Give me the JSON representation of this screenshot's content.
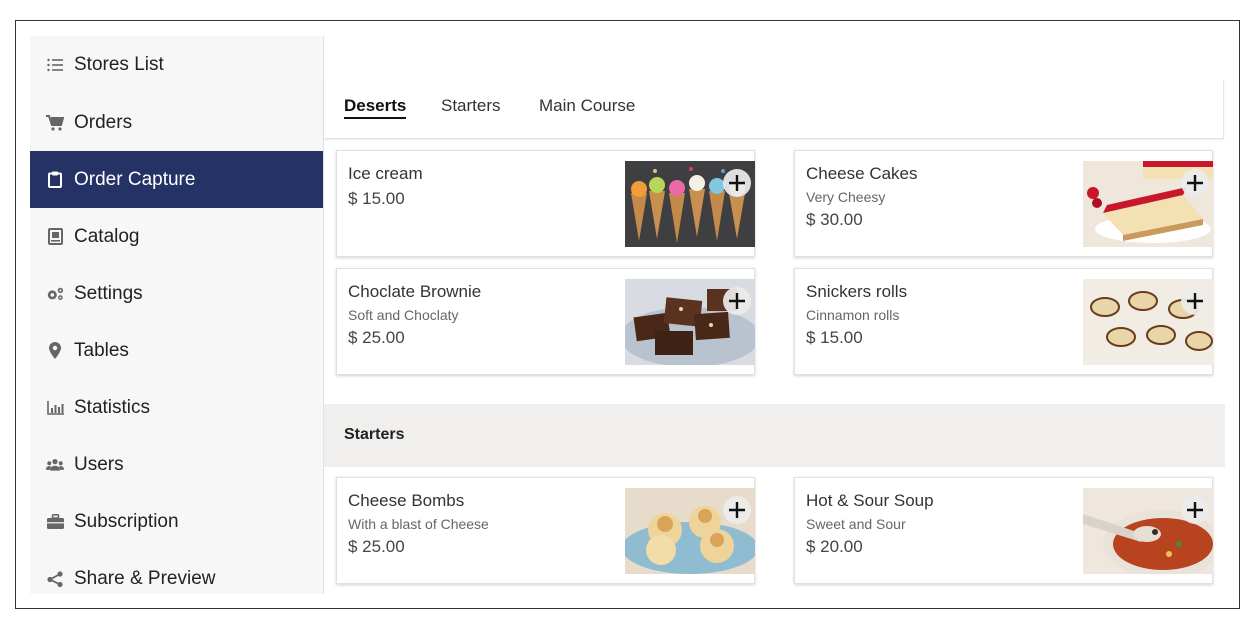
{
  "sidebar": {
    "title": "Stores List",
    "items": [
      {
        "label": "Orders",
        "icon": "cart-icon"
      },
      {
        "label": "Order Capture",
        "icon": "clipboard-icon",
        "active": true
      },
      {
        "label": "Catalog",
        "icon": "catalog-icon"
      },
      {
        "label": "Settings",
        "icon": "gears-icon"
      },
      {
        "label": "Tables",
        "icon": "map-pin-icon"
      },
      {
        "label": "Statistics",
        "icon": "bar-chart-icon"
      },
      {
        "label": "Users",
        "icon": "users-icon"
      },
      {
        "label": "Subscription",
        "icon": "briefcase-icon"
      },
      {
        "label": "Share & Preview",
        "icon": "share-icon"
      }
    ]
  },
  "tabs": [
    {
      "label": "Deserts",
      "active": true
    },
    {
      "label": "Starters"
    },
    {
      "label": "Main Course"
    }
  ],
  "deserts": [
    {
      "name": "Ice cream",
      "desc": "",
      "price": "$ 15.00",
      "image": "ice-cream-cones-image"
    },
    {
      "name": "Cheese Cakes",
      "desc": "Very Cheesy",
      "price": "$ 30.00",
      "image": "cheesecake-image"
    },
    {
      "name": "Choclate Brownie",
      "desc": "Soft and Choclaty",
      "price": "$ 25.00",
      "image": "brownie-image"
    },
    {
      "name": "Snickers rolls",
      "desc": "Cinnamon rolls",
      "price": "$ 15.00",
      "image": "snickers-rolls-image"
    }
  ],
  "starters_section": {
    "title": "Starters",
    "items": [
      {
        "name": "Cheese Bombs",
        "desc": "With a blast of Cheese",
        "price": "$ 25.00",
        "image": "cheese-bombs-image"
      },
      {
        "name": "Hot & Sour Soup",
        "desc": "Sweet and Sour",
        "price": "$ 20.00",
        "image": "soup-image"
      }
    ]
  },
  "colors": {
    "sidebar_active": "#243266",
    "sidebar_bg": "#f7f7f7",
    "section_bg": "#f0efee"
  }
}
